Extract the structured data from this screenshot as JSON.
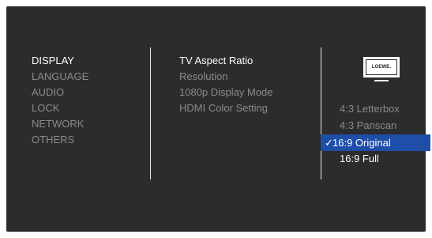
{
  "categories": [
    {
      "label": "DISPLAY",
      "active": true
    },
    {
      "label": "LANGUAGE",
      "active": false
    },
    {
      "label": "AUDIO",
      "active": false
    },
    {
      "label": "LOCK",
      "active": false
    },
    {
      "label": "NETWORK",
      "active": false
    },
    {
      "label": "OTHERS",
      "active": false
    }
  ],
  "settings": [
    {
      "label": "TV Aspect Ratio",
      "active": true
    },
    {
      "label": "Resolution",
      "active": false
    },
    {
      "label": "1080p Display Mode",
      "active": false
    },
    {
      "label": "HDMI Color Setting",
      "active": false
    }
  ],
  "tv_logo": "LOEWE.",
  "options": [
    {
      "label": "4:3 Letterbox",
      "state": "dim"
    },
    {
      "label": "4:3 Panscan",
      "state": "dim"
    },
    {
      "label": "16:9 Original",
      "state": "selected"
    },
    {
      "label": "16:9 Full",
      "state": "normal"
    }
  ],
  "selected_mark": "✓",
  "colors": {
    "background": "#2c2c2c",
    "highlight": "#1f4ea8",
    "active_text": "#ffffff",
    "dim_text": "#8a8a8a"
  }
}
